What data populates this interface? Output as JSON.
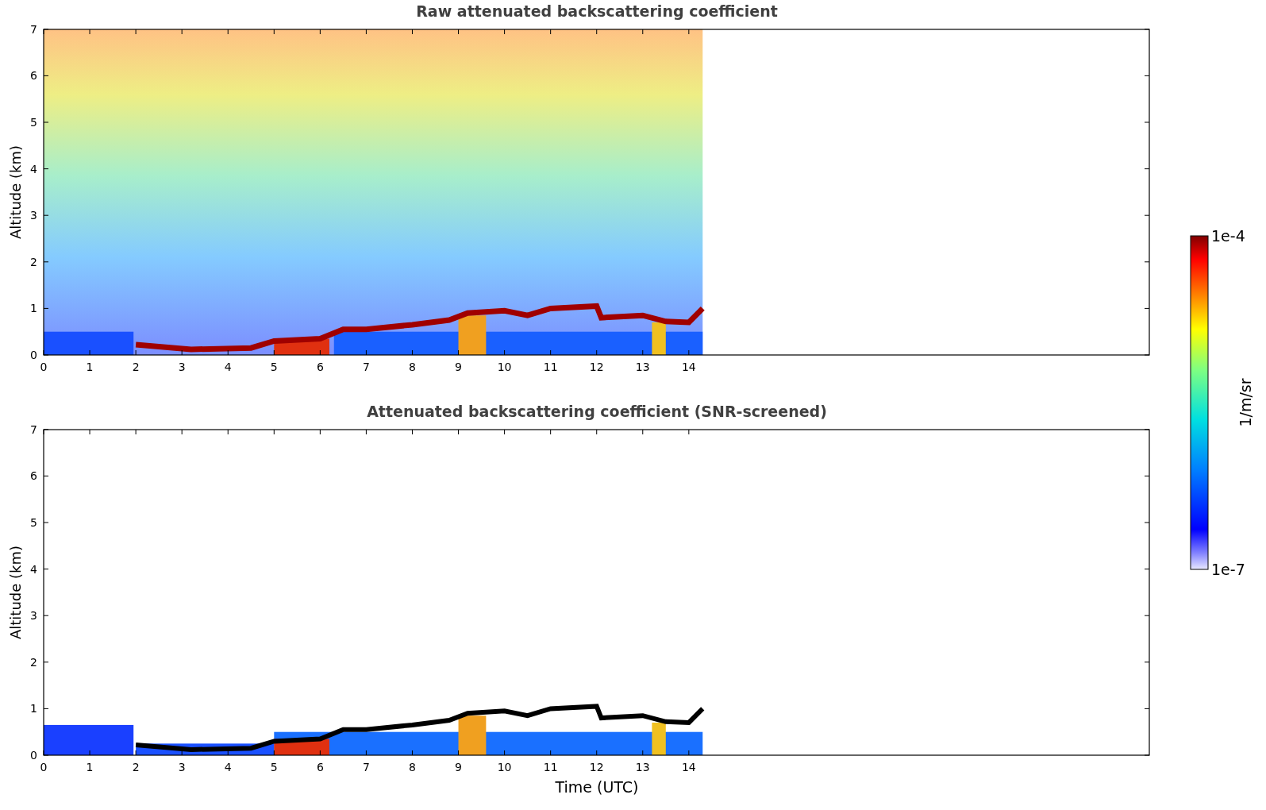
{
  "panels": [
    {
      "kind": "raw",
      "title": "Raw attenuated backscattering coefficient",
      "ylabel": "Altitude (km)",
      "yticks": [
        "7",
        "6",
        "5",
        "4",
        "3",
        "2",
        "1",
        "0"
      ],
      "xticks": [
        "0",
        "1",
        "2",
        "3",
        "4",
        "5",
        "6",
        "7",
        "8",
        "9",
        "10",
        "11",
        "12",
        "13",
        "14"
      ]
    },
    {
      "kind": "screened",
      "title": "Attenuated backscattering coefficient (SNR-screened)",
      "ylabel": "Altitude (km)",
      "yticks": [
        "7",
        "6",
        "5",
        "4",
        "3",
        "2",
        "1",
        "0"
      ],
      "xticks": [
        "0",
        "1",
        "2",
        "3",
        "4",
        "5",
        "6",
        "7",
        "8",
        "9",
        "10",
        "11",
        "12",
        "13",
        "14"
      ],
      "xlabel": "Time (UTC)"
    }
  ],
  "colorbar": {
    "max_label": "1e-4",
    "min_label": "1e-7",
    "label": "1/m/sr"
  }
}
